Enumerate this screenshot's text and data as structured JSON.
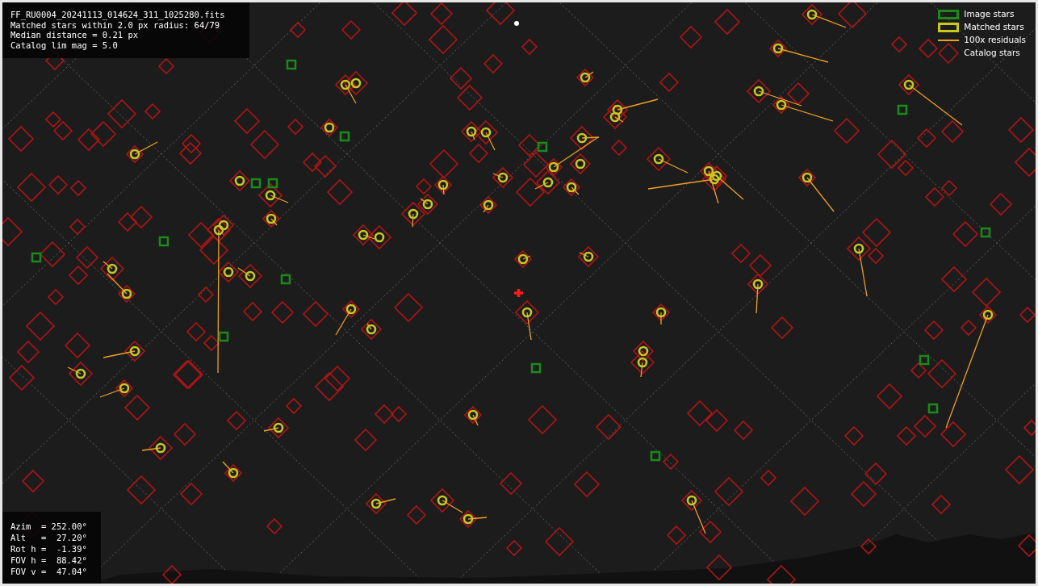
{
  "info_box": {
    "lines": [
      "FF_RU0004_20241113_014624_311_1025280.fits",
      "Matched stars within 2.0 px radius: 64/79",
      "Median distance = 0.21 px",
      "Catalog lim mag = 5.0"
    ]
  },
  "legend": {
    "items": [
      {
        "kind": "box",
        "color": "#1a8a1a",
        "label": "Image stars"
      },
      {
        "kind": "box",
        "color": "#c8c81e",
        "label": "Matched stars"
      },
      {
        "kind": "line",
        "color": "#f0a020",
        "label": "100x residuals"
      },
      {
        "kind": "diamond",
        "color": "#b01515",
        "label": "Catalog stars"
      }
    ]
  },
  "pointing_box": {
    "lines": [
      "Azim  = 252.00°",
      "Alt   =  27.20°",
      "Rot h =  -1.39°",
      "FOV h =  88.42°",
      "FOV v =  47.04°"
    ]
  }
}
